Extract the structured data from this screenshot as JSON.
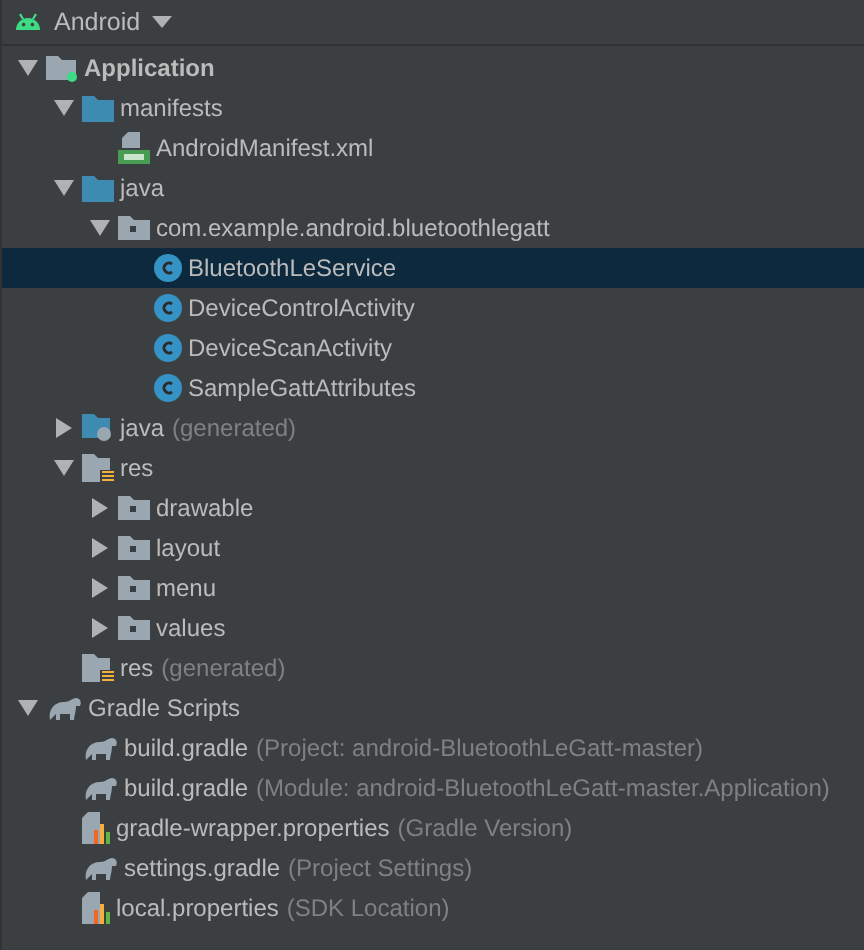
{
  "view_selector": {
    "label": "Android"
  },
  "tree": [
    {
      "kind": "module",
      "label": "Application",
      "expanded": true,
      "selected": false,
      "children": [
        {
          "kind": "folder",
          "label": "manifests",
          "expanded": true,
          "selected": false,
          "children": [
            {
              "kind": "manifest",
              "label": "AndroidManifest.xml",
              "selected": false
            }
          ]
        },
        {
          "kind": "folder",
          "label": "java",
          "expanded": true,
          "selected": false,
          "children": [
            {
              "kind": "package",
              "label": "com.example.android.bluetoothlegatt",
              "expanded": true,
              "selected": false,
              "children": [
                {
                  "kind": "class",
                  "label": "BluetoothLeService",
                  "selected": true
                },
                {
                  "kind": "class",
                  "label": "DeviceControlActivity",
                  "selected": false
                },
                {
                  "kind": "class",
                  "label": "DeviceScanActivity",
                  "selected": false
                },
                {
                  "kind": "class",
                  "label": "SampleGattAttributes",
                  "selected": false
                }
              ]
            }
          ]
        },
        {
          "kind": "generated",
          "label": "java",
          "note": "(generated)",
          "expanded": false,
          "selected": false
        },
        {
          "kind": "resources",
          "label": "res",
          "expanded": true,
          "selected": false,
          "children": [
            {
              "kind": "package",
              "label": "drawable",
              "expanded": false,
              "selected": false
            },
            {
              "kind": "package",
              "label": "layout",
              "expanded": false,
              "selected": false
            },
            {
              "kind": "package",
              "label": "menu",
              "expanded": false,
              "selected": false
            },
            {
              "kind": "package",
              "label": "values",
              "expanded": false,
              "selected": false
            }
          ]
        },
        {
          "kind": "resources",
          "label": "res",
          "note": "(generated)",
          "selected": false
        }
      ]
    },
    {
      "kind": "gradle",
      "label": "Gradle Scripts",
      "expanded": true,
      "selected": false,
      "children": [
        {
          "kind": "gradle",
          "label": "build.gradle",
          "note": "(Project: android-BluetoothLeGatt-master)",
          "selected": false
        },
        {
          "kind": "gradle",
          "label": "build.gradle",
          "note": "(Module: android-BluetoothLeGatt-master.Application)",
          "selected": false
        },
        {
          "kind": "properties",
          "label": "gradle-wrapper.properties",
          "note": "(Gradle Version)",
          "selected": false
        },
        {
          "kind": "gradle",
          "label": "settings.gradle",
          "note": "(Project Settings)",
          "selected": false
        },
        {
          "kind": "properties",
          "label": "local.properties",
          "note": "(SDK Location)",
          "selected": false
        }
      ]
    }
  ]
}
